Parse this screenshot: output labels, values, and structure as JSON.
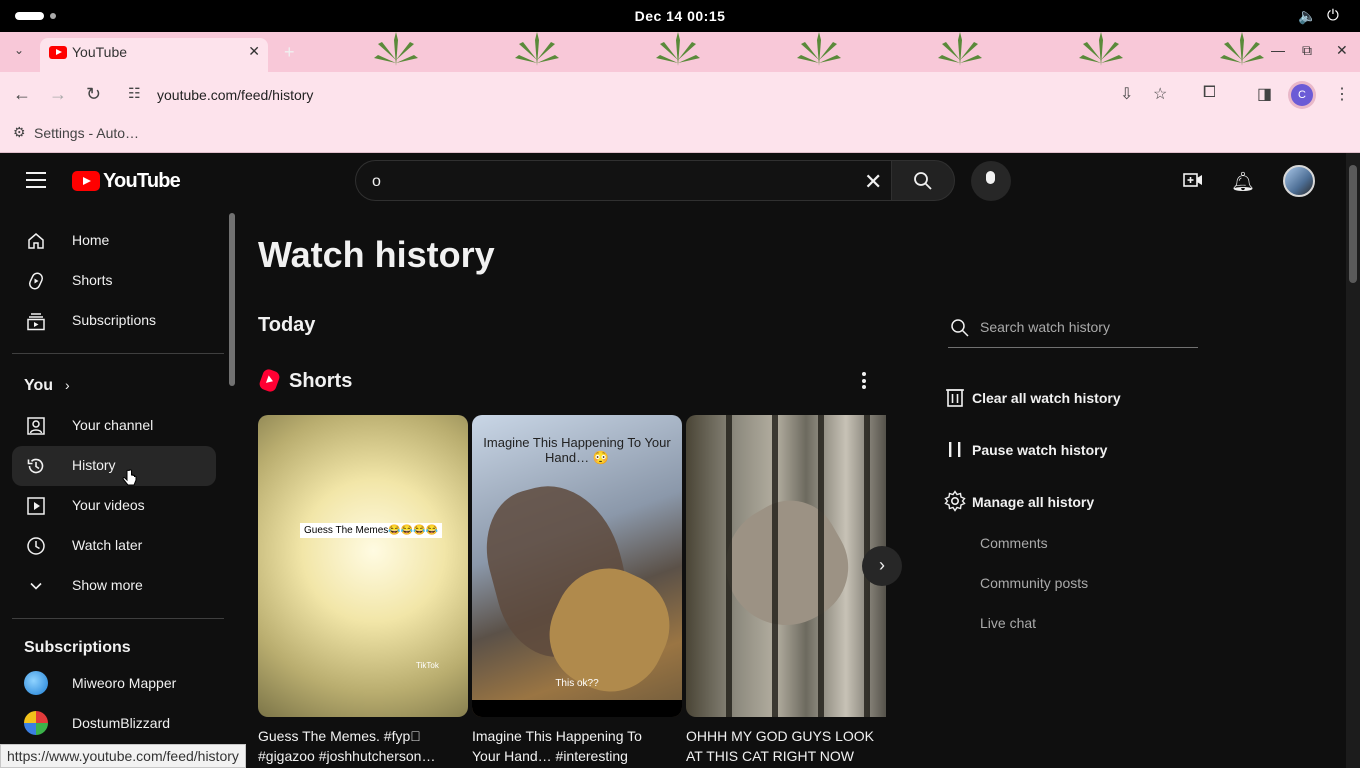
{
  "system": {
    "clock": "Dec 14  00:15",
    "volume_icon": "volume-icon",
    "power_icon": "power-icon"
  },
  "browser": {
    "tab_title": "YouTube",
    "url": "youtube.com/feed/history",
    "bookmark": "Settings - Auto…",
    "profile_initial": "C",
    "theme_color": "#f8c8d8"
  },
  "youtube": {
    "logo_text": "YouTube",
    "search_query": "o",
    "sidebar": {
      "main": [
        {
          "label": "Home",
          "icon": "home-icon"
        },
        {
          "label": "Shorts",
          "icon": "shorts-icon"
        },
        {
          "label": "Subscriptions",
          "icon": "subscriptions-icon"
        }
      ],
      "you_label": "You",
      "you_items": [
        {
          "label": "Your channel",
          "icon": "person-icon"
        },
        {
          "label": "History",
          "icon": "history-icon",
          "active": true
        },
        {
          "label": "Your videos",
          "icon": "play-icon"
        },
        {
          "label": "Watch later",
          "icon": "clock-icon"
        },
        {
          "label": "Show more",
          "icon": "chevron-down-icon"
        }
      ],
      "subscriptions_title": "Subscriptions",
      "subscriptions": [
        {
          "label": "Miweoro Mapper",
          "color": "#2e8de0"
        },
        {
          "label": "DostumBlizzard",
          "color": "#d9d9d9"
        }
      ]
    },
    "page": {
      "title": "Watch history",
      "section": "Today",
      "shorts_label": "Shorts",
      "shorts": [
        {
          "title": "Guess The Memes. #fyp\u0000 #gigazoo #joshhutcherson…",
          "overlay": "Guess The Memes😂😂😂😂",
          "watermark": "TikTok"
        },
        {
          "title": "Imagine This Happening To Your Hand… #interesting",
          "overlay": "Imagine This Happening To Your Hand… 😳",
          "subtitle": "This ok??"
        },
        {
          "title": "OHHH MY GOD GUYS LOOK AT THIS CAT RIGHT NOW"
        }
      ]
    },
    "history_panel": {
      "search_placeholder": "Search watch history",
      "clear_label": "Clear all watch history",
      "pause_label": "Pause watch history",
      "manage_label": "Manage all history",
      "sub_items": [
        "Comments",
        "Community posts",
        "Live chat"
      ]
    }
  },
  "status_url": "https://www.youtube.com/feed/history"
}
